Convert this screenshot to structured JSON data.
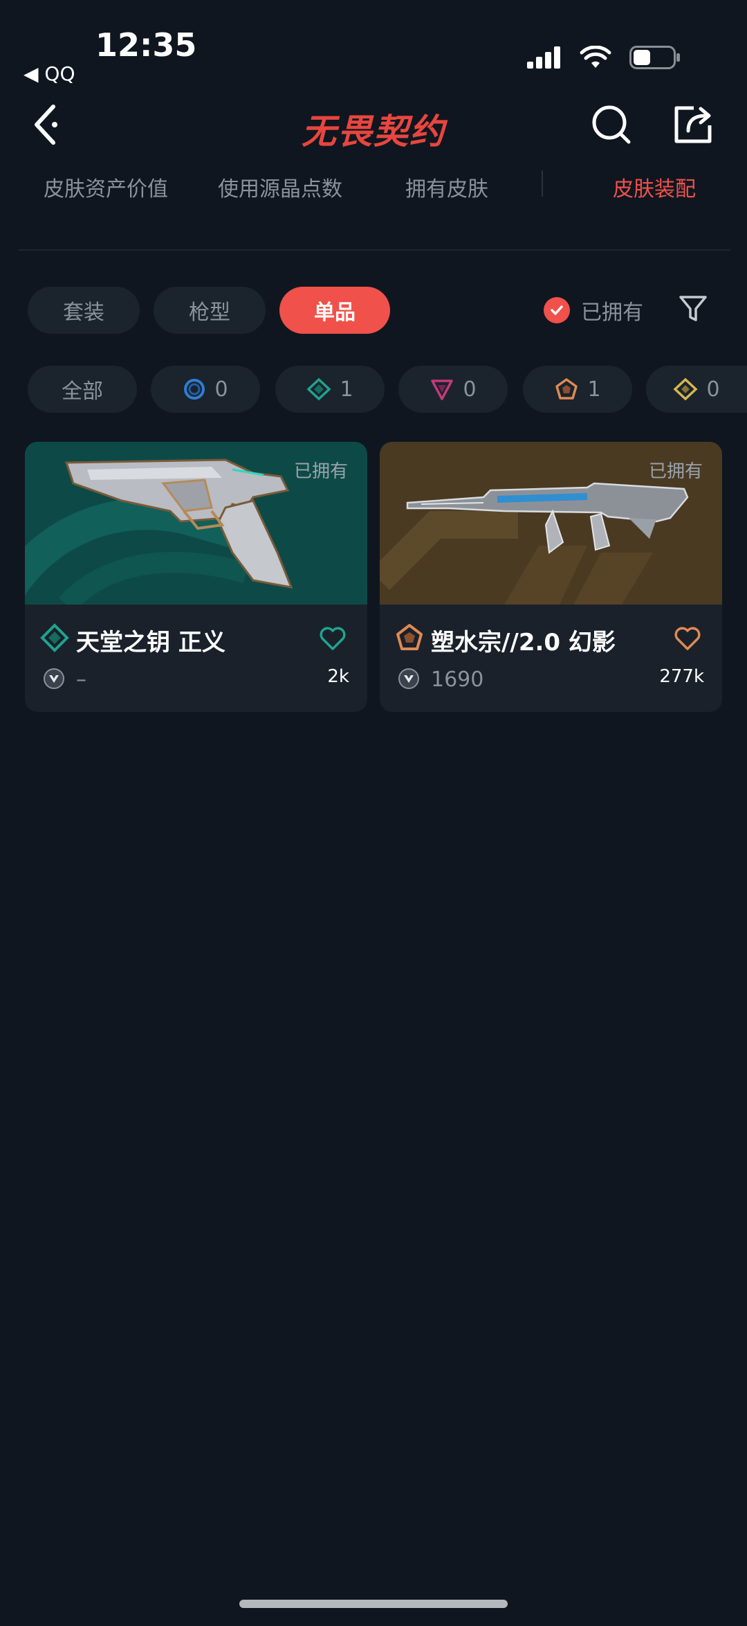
{
  "status_bar": {
    "time": "12:35",
    "back_app": "◀ QQ"
  },
  "header": {
    "title": "无畏契约"
  },
  "tabs": [
    {
      "label": "皮肤资产价值"
    },
    {
      "label": "使用源晶点数"
    },
    {
      "label": "拥有皮肤"
    },
    {
      "label": "皮肤装配"
    }
  ],
  "type_filters": [
    {
      "label": "套装"
    },
    {
      "label": "枪型"
    },
    {
      "label": "单品"
    }
  ],
  "owned_filter": {
    "label": "已拥有"
  },
  "rarity_filters": {
    "all_label": "全部",
    "items": [
      {
        "icon": "select-tier-icon",
        "color": "#2f7dd1",
        "count": "0"
      },
      {
        "icon": "deluxe-tier-icon",
        "color": "#1fa38f",
        "count": "1"
      },
      {
        "icon": "premium-tier-icon",
        "color": "#c23a7a",
        "count": "0"
      },
      {
        "icon": "exclusive-tier-icon",
        "color": "#e08a52",
        "count": "1"
      },
      {
        "icon": "ultra-tier-icon",
        "color": "#d6b650",
        "count": "0"
      }
    ]
  },
  "skins": [
    {
      "name": "天堂之钥 正义",
      "owned_label": "已拥有",
      "price": "–",
      "likes": "2k",
      "tier_color": "#1fa38f",
      "bg_color": "#0d4a47"
    },
    {
      "name": "塑水宗//2.0 幻影",
      "owned_label": "已拥有",
      "price": "1690",
      "likes": "277k",
      "tier_color": "#e08a52",
      "bg_color": "#4a3a22"
    }
  ],
  "colors": {
    "accent": "#f0514a",
    "background": "#0f1620",
    "card": "#1a212b"
  }
}
